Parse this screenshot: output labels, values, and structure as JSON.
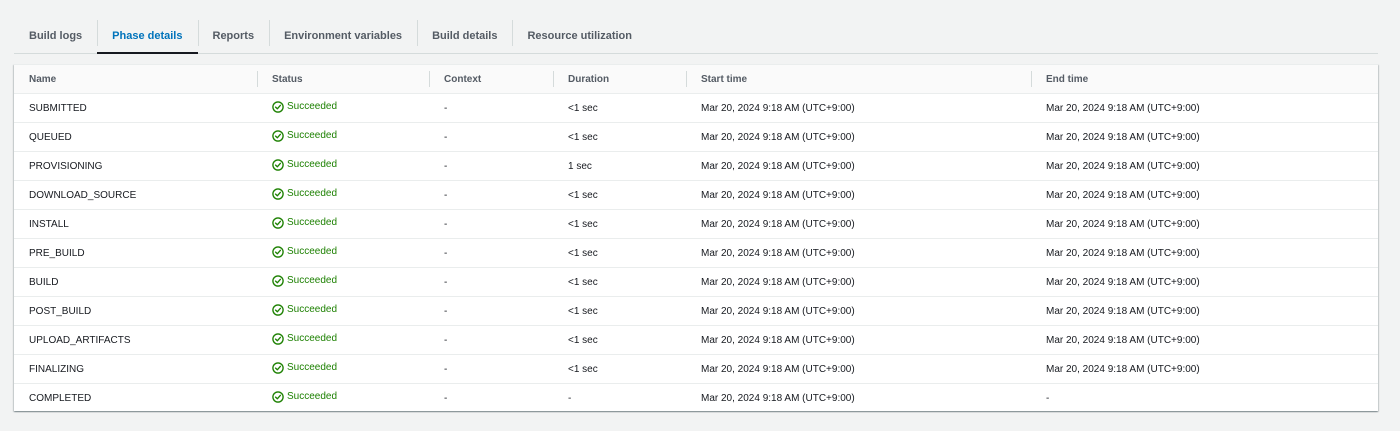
{
  "tabs": [
    {
      "label": "Build logs",
      "active": false
    },
    {
      "label": "Phase details",
      "active": true
    },
    {
      "label": "Reports",
      "active": false
    },
    {
      "label": "Environment variables",
      "active": false
    },
    {
      "label": "Build details",
      "active": false
    },
    {
      "label": "Resource utilization",
      "active": false
    }
  ],
  "table": {
    "headers": {
      "name": "Name",
      "status": "Status",
      "context": "Context",
      "duration": "Duration",
      "start_time": "Start time",
      "end_time": "End time"
    },
    "status_icon": "check-circle-icon",
    "status_color": "#1d8102",
    "rows": [
      {
        "name": "SUBMITTED",
        "status": "Succeeded",
        "context": "-",
        "duration": "<1 sec",
        "start_time": "Mar 20, 2024 9:18 AM (UTC+9:00)",
        "end_time": "Mar 20, 2024 9:18 AM (UTC+9:00)"
      },
      {
        "name": "QUEUED",
        "status": "Succeeded",
        "context": "-",
        "duration": "<1 sec",
        "start_time": "Mar 20, 2024 9:18 AM (UTC+9:00)",
        "end_time": "Mar 20, 2024 9:18 AM (UTC+9:00)"
      },
      {
        "name": "PROVISIONING",
        "status": "Succeeded",
        "context": "-",
        "duration": "1 sec",
        "start_time": "Mar 20, 2024 9:18 AM (UTC+9:00)",
        "end_time": "Mar 20, 2024 9:18 AM (UTC+9:00)"
      },
      {
        "name": "DOWNLOAD_SOURCE",
        "status": "Succeeded",
        "context": "-",
        "duration": "<1 sec",
        "start_time": "Mar 20, 2024 9:18 AM (UTC+9:00)",
        "end_time": "Mar 20, 2024 9:18 AM (UTC+9:00)"
      },
      {
        "name": "INSTALL",
        "status": "Succeeded",
        "context": "-",
        "duration": "<1 sec",
        "start_time": "Mar 20, 2024 9:18 AM (UTC+9:00)",
        "end_time": "Mar 20, 2024 9:18 AM (UTC+9:00)"
      },
      {
        "name": "PRE_BUILD",
        "status": "Succeeded",
        "context": "-",
        "duration": "<1 sec",
        "start_time": "Mar 20, 2024 9:18 AM (UTC+9:00)",
        "end_time": "Mar 20, 2024 9:18 AM (UTC+9:00)"
      },
      {
        "name": "BUILD",
        "status": "Succeeded",
        "context": "-",
        "duration": "<1 sec",
        "start_time": "Mar 20, 2024 9:18 AM (UTC+9:00)",
        "end_time": "Mar 20, 2024 9:18 AM (UTC+9:00)"
      },
      {
        "name": "POST_BUILD",
        "status": "Succeeded",
        "context": "-",
        "duration": "<1 sec",
        "start_time": "Mar 20, 2024 9:18 AM (UTC+9:00)",
        "end_time": "Mar 20, 2024 9:18 AM (UTC+9:00)"
      },
      {
        "name": "UPLOAD_ARTIFACTS",
        "status": "Succeeded",
        "context": "-",
        "duration": "<1 sec",
        "start_time": "Mar 20, 2024 9:18 AM (UTC+9:00)",
        "end_time": "Mar 20, 2024 9:18 AM (UTC+9:00)"
      },
      {
        "name": "FINALIZING",
        "status": "Succeeded",
        "context": "-",
        "duration": "<1 sec",
        "start_time": "Mar 20, 2024 9:18 AM (UTC+9:00)",
        "end_time": "Mar 20, 2024 9:18 AM (UTC+9:00)"
      },
      {
        "name": "COMPLETED",
        "status": "Succeeded",
        "context": "-",
        "duration": "-",
        "start_time": "Mar 20, 2024 9:18 AM (UTC+9:00)",
        "end_time": "-"
      }
    ]
  }
}
